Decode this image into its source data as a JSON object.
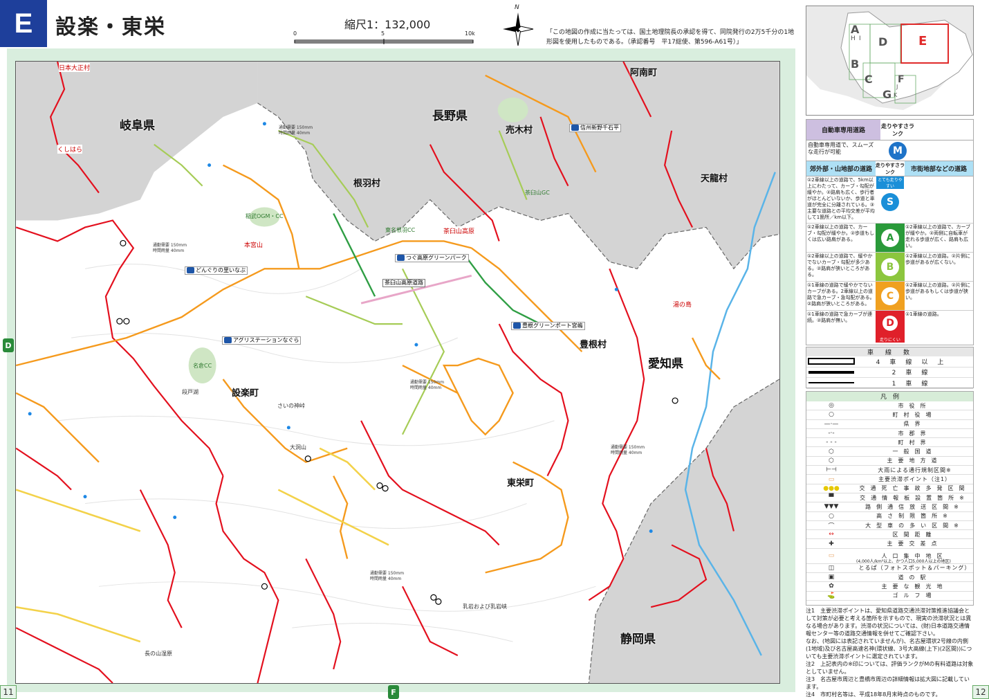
{
  "header": {
    "section_letter": "E",
    "title": "設楽・東栄",
    "scale": "縮尺1：132,000",
    "scale_ticks": [
      "0",
      "5",
      "10k"
    ],
    "north_label": "N",
    "copyright": "「この地図の作成に当たっては、国土地理院長の承認を得て、同院発行の2万5千分の1地形図を使用したものである。（承認番号　平17総使、第596-A61号）」"
  },
  "map": {
    "prefectures": [
      "岐阜県",
      "長野県",
      "愛知県",
      "静岡県"
    ],
    "municipalities": [
      "根羽村",
      "売木村",
      "阿南町",
      "天龍村",
      "設楽町",
      "豊根村",
      "東栄町"
    ],
    "pois": [
      "くしはら",
      "日本大正村",
      "湯の島",
      "茶臼山高原",
      "本宮山"
    ],
    "signs": [
      "茶臼山高原道路",
      "どんぐりの里いなぶ",
      "つぐ高原グリーンパーク",
      "豊根グリーンポート宮嶋",
      "アグリステーションなぐら",
      "信州新野千石平"
    ],
    "places": [
      "稲武OGM・CC",
      "名倉CC",
      "東名根羽CC",
      "茶臼山GC",
      "さいの神峠",
      "長の山湿原",
      "乳岩および乳岩峡",
      "大洞山",
      "段戸湖"
    ],
    "traffic_info": [
      "通勤需要 150mm",
      "時間雨量 40mm"
    ],
    "page_left": "11",
    "page_right": "12",
    "edge_markers": [
      "D",
      "F"
    ]
  },
  "index_map": {
    "letters": [
      "A",
      "H",
      "I",
      "B",
      "C",
      "D",
      "E",
      "F",
      "G",
      "J",
      "K"
    ],
    "highlight": "E",
    "highlight_color": "#e02a2a"
  },
  "rank_panel": {
    "header_left": "自動車専用道路",
    "header_right": "走りやすさランク",
    "motorway_desc": "自動車専用道で、スムーズな走行が可能",
    "motorway_rank": "M",
    "col_left": "郊外部・山地部の道路",
    "col_mid": "走りやすさランク",
    "col_right": "市街地部などの道路",
    "arrow_top": "とても走りやすい",
    "arrow_bottom": "走りにくい",
    "ranks": [
      {
        "rank": "S",
        "color": "#1a8fd8",
        "left": "①2車線以上の道路で、5km以上にわたって、カーブ・勾配が緩やか。②路肩も広く、歩行者がほとんどいないか、歩道と車道が完全に分離されている。③主要な道路との平均交差が平均して1箇所／km以下。",
        "right": ""
      },
      {
        "rank": "A",
        "color": "#2a9a3a",
        "left": "①2車線以上の道路で、カーブ・勾配が緩やか。②歩道もしくは広い路肩がある。",
        "right": "①2車線以上の道路で、カーブが緩やか。②両側に自転車が走れる歩道が広く、路肩も広い。"
      },
      {
        "rank": "B",
        "color": "#8cc63e",
        "left": "①2車線以上の道路で、緩やかでないカーブ・勾配が多少ある。②路肩が狭いところがある。",
        "right": "①2車線以上の道路。②片側に歩道があるが広くない。"
      },
      {
        "rank": "C",
        "color": "#f0a020",
        "left": "①1車線の道路で緩やかでないカーブがある。2車線以上の道路で急カーブ・急勾配がある。②路肩が狭いところがある。",
        "right": "①2車線以上の道路。②片側に歩道があるもしくは歩道が狭い。"
      },
      {
        "rank": "D",
        "color": "#e0202a",
        "left": "①1車線の道路で急カーブが連続。②路肩が無い。",
        "right": "①1車線の道路。"
      }
    ]
  },
  "lanes_panel": {
    "title": "車　線　数",
    "rows": [
      "4車線以上",
      "2車線",
      "1車線"
    ]
  },
  "legend": {
    "title": "凡　例",
    "items": [
      {
        "icon": "city-hall-icon",
        "label": "市役所"
      },
      {
        "icon": "town-hall-icon",
        "label": "町村役場"
      },
      {
        "icon": "pref-border-icon",
        "label": "県界"
      },
      {
        "icon": "county-border-icon",
        "label": "市郡界"
      },
      {
        "icon": "town-border-icon",
        "label": "町村界"
      },
      {
        "icon": "national-road-icon",
        "label": "一般国道"
      },
      {
        "icon": "main-road-icon",
        "label": "主要地方道"
      },
      {
        "icon": "rain-closure-icon",
        "label": "大雨による通行規制区間※"
      },
      {
        "icon": "congestion-point-icon",
        "label": "主要渋滞ポイント（注1）"
      },
      {
        "icon": "accident-zone-icon",
        "label": "交通死亡事故多発区間"
      },
      {
        "icon": "info-board-icon",
        "label": "交通情報板設置箇所※"
      },
      {
        "icon": "freeze-zone-icon",
        "label": "路側通信放送区間※"
      },
      {
        "icon": "height-limit-icon",
        "label": "高さ制限箇所※"
      },
      {
        "icon": "large-vehicle-icon",
        "label": "大型車の多い区間※"
      },
      {
        "icon": "distance-icon",
        "label": "区間距離"
      },
      {
        "icon": "main-intersection-icon",
        "label": "主要交差点"
      },
      {
        "icon": "did-area-icon",
        "label": "人口集中地区"
      },
      {
        "icon": "photo-spot-icon",
        "label": "とるぱ（フォトスポット＆パーキング）"
      },
      {
        "icon": "roadside-station-icon",
        "label": "道の駅"
      },
      {
        "icon": "sightseeing-icon",
        "label": "主要な観光地"
      },
      {
        "icon": "golf-icon",
        "label": "ゴルフ場"
      }
    ],
    "did_note": "(4,000人/km²以上、かつ人口5,000人以上の地区)"
  },
  "notes": [
    "注1　主要渋滞ポイントは、愛知県道路交通渋滞対策推進協議会として対策が必要と考える箇所を示すもので、現実の渋滞状況とは異なる場合があります。渋滞の状況については、(財)日本道路交通情報センター等の道路交通情報を併せてご確認下さい。",
    "なお、(地図には表記されていませんが)、名古屋環状2号線の内側(1地域)及び名古屋高速名神(環状線、3号大高線(上下)(2区間))についても主要渋滞ポイントに選定されています。",
    "注2　上記表内の※印については、評価ランクがMの有料道路は対象としていません。",
    "注3　名古屋市周辺と豊橋市周辺の詳細情報は拡大図に記載しています。",
    "注4　市町村名等は、平成18年8月末時点のものです。"
  ]
}
